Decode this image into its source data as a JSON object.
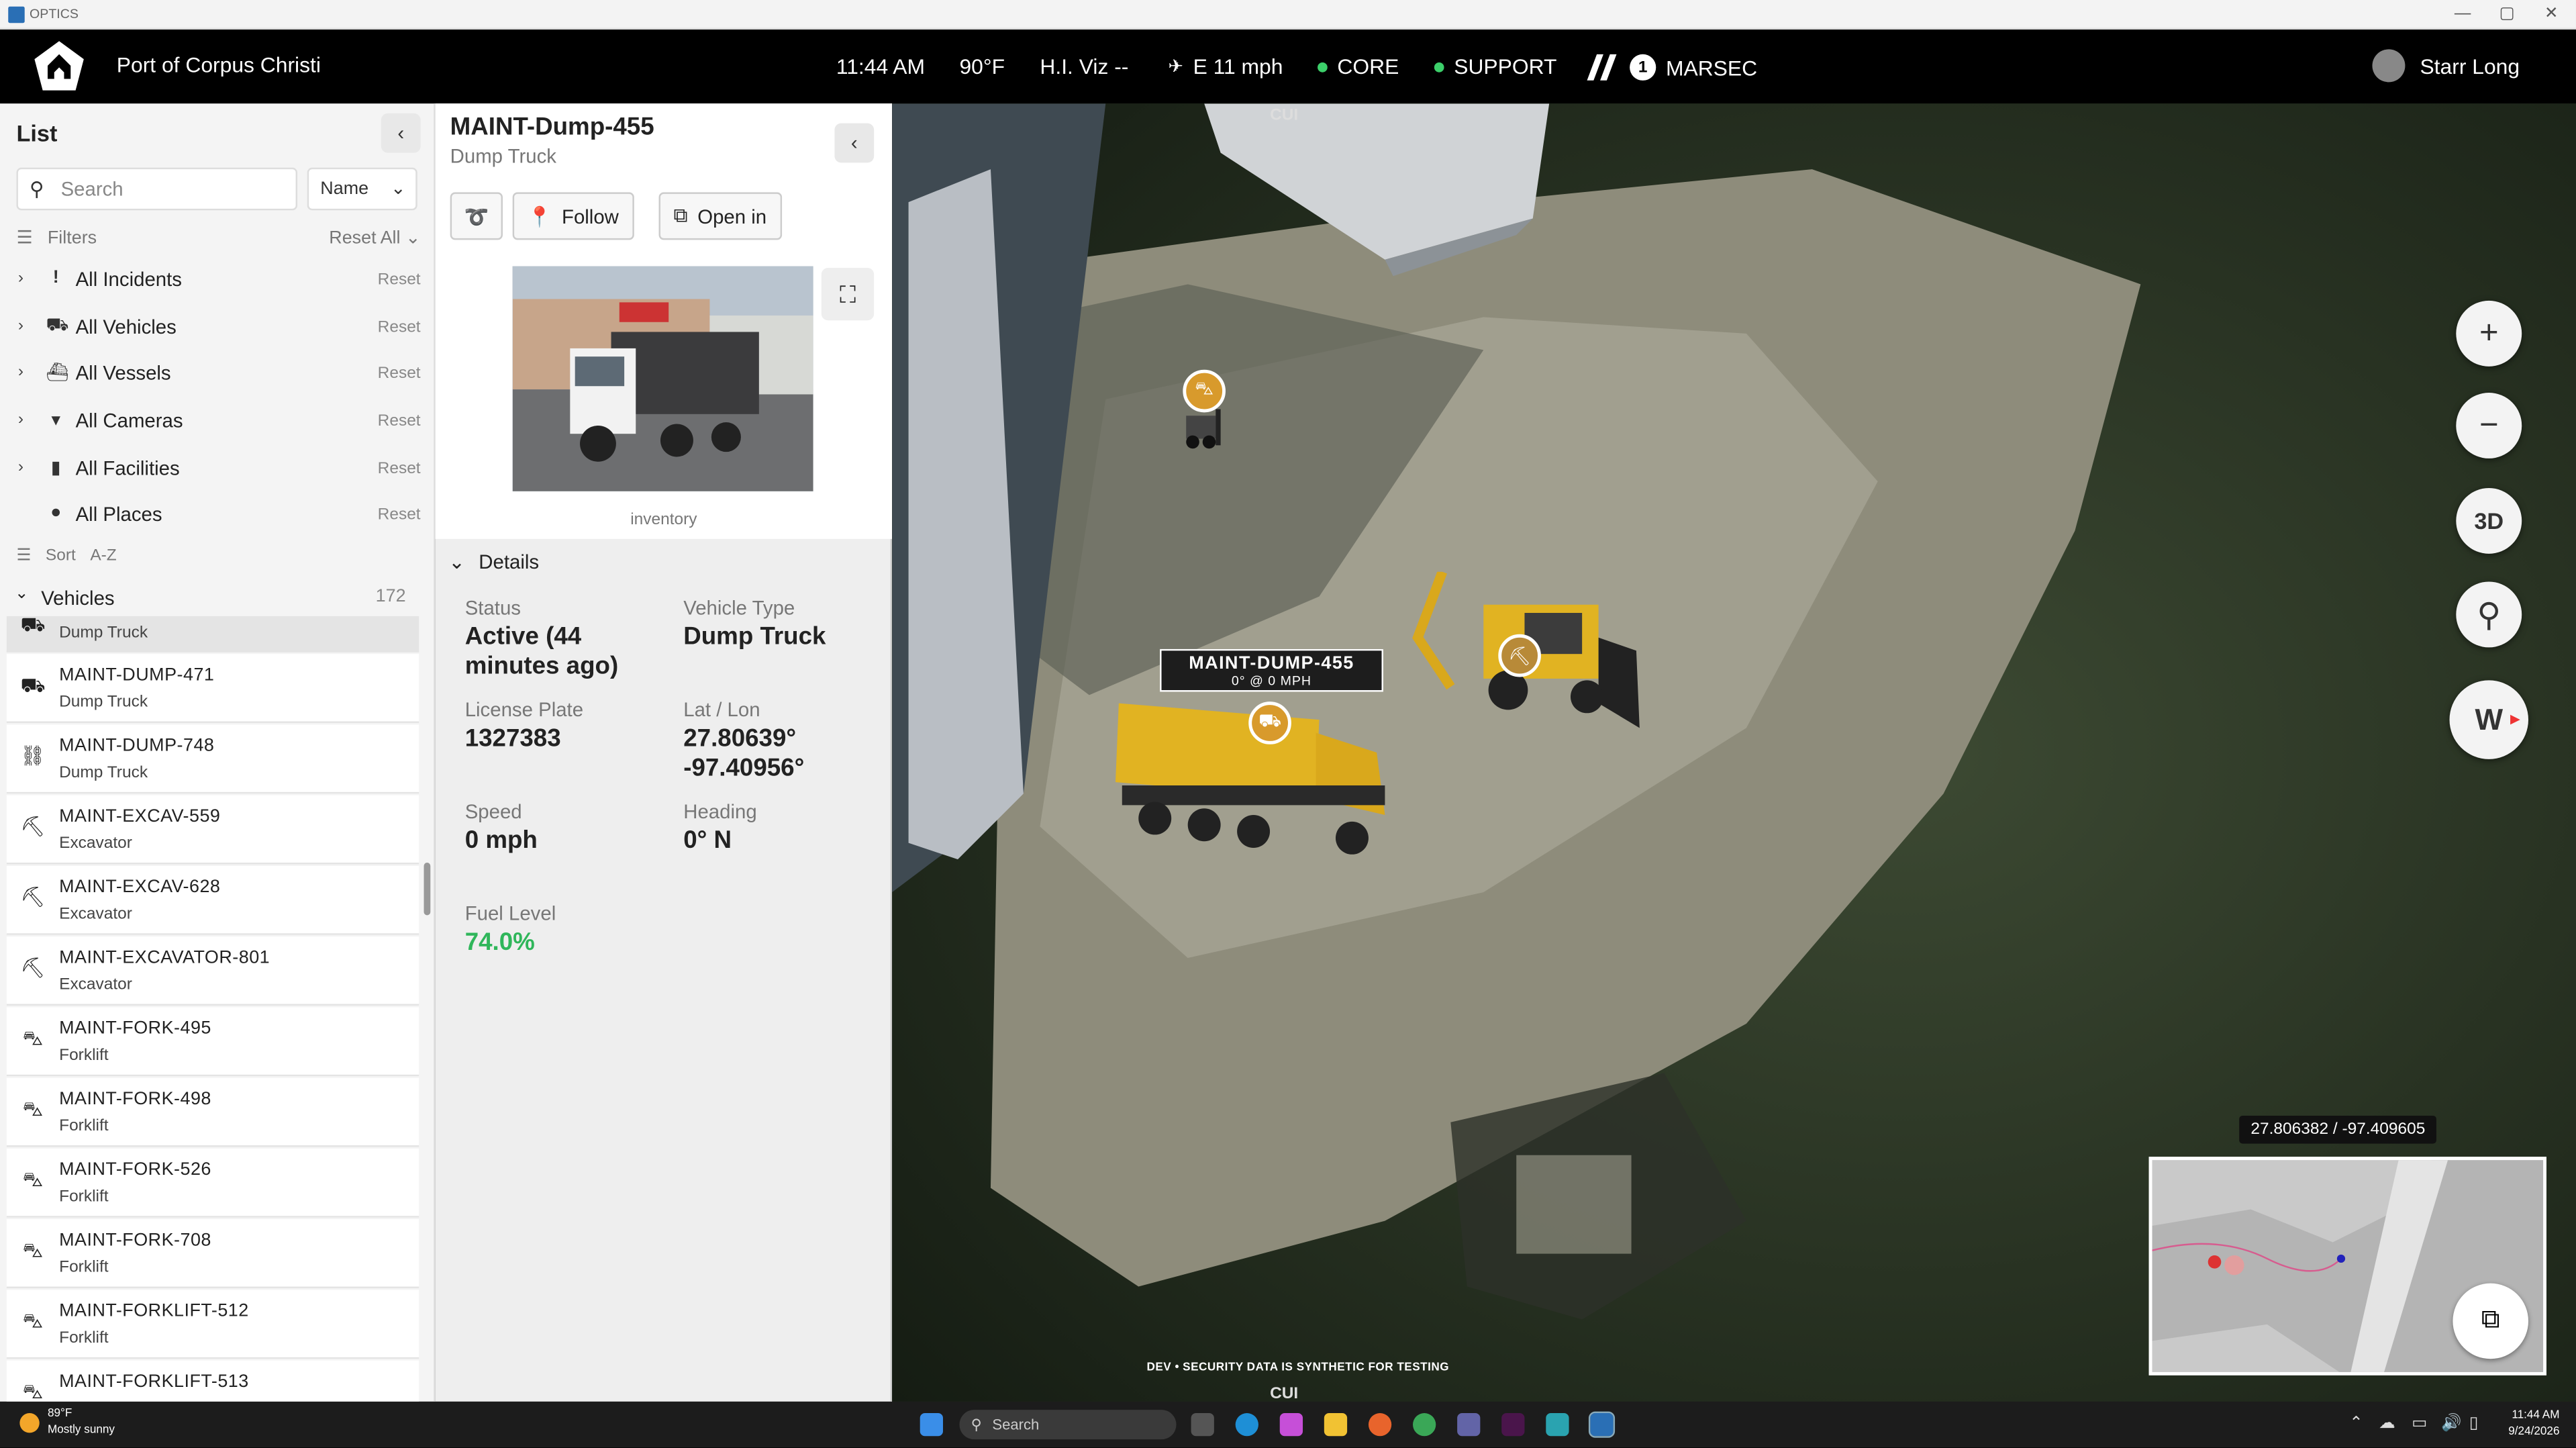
{
  "window": {
    "title": "OPTICS",
    "controls": [
      "—",
      "▢",
      "✕"
    ]
  },
  "header": {
    "port": "Port of Corpus Christi",
    "time": "11:44 AM",
    "temp": "90°F",
    "hiviz": "H.I. Viz --",
    "wind": "E 11 mph",
    "core": "CORE",
    "support": "SUPPORT",
    "marsec_level": "1",
    "marsec": "MARSEC",
    "user": "Starr Long",
    "status_color": "#3ccf6a"
  },
  "list": {
    "title": "List",
    "search_placeholder": "Search",
    "sort_by": "Name",
    "filters_label": "Filters",
    "reset_all": "Reset All",
    "filters": [
      {
        "label": "All Incidents",
        "icon": "exclamation-icon",
        "glyph": "!",
        "reset": "Reset"
      },
      {
        "label": "All Vehicles",
        "icon": "truck-icon",
        "glyph": "⛟",
        "reset": "Reset"
      },
      {
        "label": "All Vessels",
        "icon": "ship-icon",
        "glyph": "⛴",
        "reset": "Reset"
      },
      {
        "label": "All Cameras",
        "icon": "camera-icon",
        "glyph": "▾",
        "reset": "Reset"
      },
      {
        "label": "All Facilities",
        "icon": "building-icon",
        "glyph": "▮",
        "reset": "Reset"
      },
      {
        "label": "All Places",
        "icon": "place-pin-icon",
        "glyph": "●",
        "reset": "Reset"
      }
    ],
    "sort_label": "Sort",
    "sort_value": "A-Z",
    "group": "Vehicles",
    "group_count": "172",
    "vehicles": [
      {
        "name": "",
        "type": "Dump Truck",
        "glyph": "⛟"
      },
      {
        "name": "MAINT-DUMP-471",
        "type": "Dump Truck",
        "glyph": "⛟"
      },
      {
        "name": "MAINT-DUMP-748",
        "type": "Dump Truck",
        "glyph": "⛓"
      },
      {
        "name": "MAINT-EXCAV-559",
        "type": "Excavator",
        "glyph": "⛏"
      },
      {
        "name": "MAINT-EXCAV-628",
        "type": "Excavator",
        "glyph": "⛏"
      },
      {
        "name": "MAINT-EXCAVATOR-801",
        "type": "Excavator",
        "glyph": "⛏"
      },
      {
        "name": "MAINT-FORK-495",
        "type": "Forklift",
        "glyph": "⛍"
      },
      {
        "name": "MAINT-FORK-498",
        "type": "Forklift",
        "glyph": "⛍"
      },
      {
        "name": "MAINT-FORK-526",
        "type": "Forklift",
        "glyph": "⛍"
      },
      {
        "name": "MAINT-FORK-708",
        "type": "Forklift",
        "glyph": "⛍"
      },
      {
        "name": "MAINT-FORKLIFT-512",
        "type": "Forklift",
        "glyph": "⛍"
      },
      {
        "name": "MAINT-FORKLIFT-513",
        "type": "",
        "glyph": "⛍"
      }
    ]
  },
  "detail": {
    "title": "MAINT-Dump-455",
    "subtitle": "Dump Truck",
    "follow": "Follow",
    "open_in": "Open in",
    "photo_caption": "inventory",
    "details_label": "Details",
    "status_label": "Status",
    "status_value": "Active (44 minutes ago)",
    "vehicle_type_label": "Vehicle Type",
    "vehicle_type_value": "Dump Truck",
    "plate_label": "License Plate",
    "plate_value": "1327383",
    "latlon_label": "Lat / Lon",
    "lat_value": "27.80639°",
    "lon_value": "-97.40956°",
    "speed_label": "Speed",
    "speed_value": "0 mph",
    "heading_label": "Heading",
    "heading_value": "0° N",
    "fuel_label": "Fuel Level",
    "fuel_value": "74.0%",
    "fuel_color": "#2fb65a"
  },
  "map": {
    "cui_top": "CUI",
    "cui_bottom": "CUI",
    "zoom_in": "+",
    "zoom_out": "−",
    "view_3d": "3D",
    "compass": "W",
    "label_name": "MAINT-DUMP-455",
    "label_sub": "0° @ 0 MPH",
    "coords": "27.806382 / -97.409605",
    "dev_notice": "DEV • SECURITY DATA IS SYNTHETIC FOR TESTING",
    "pin_color": "#d89a2c"
  },
  "taskbar": {
    "temp": "89°F",
    "weather": "Mostly sunny",
    "search": "Search",
    "time": "11:44 AM",
    "date": "9/24/2026"
  }
}
